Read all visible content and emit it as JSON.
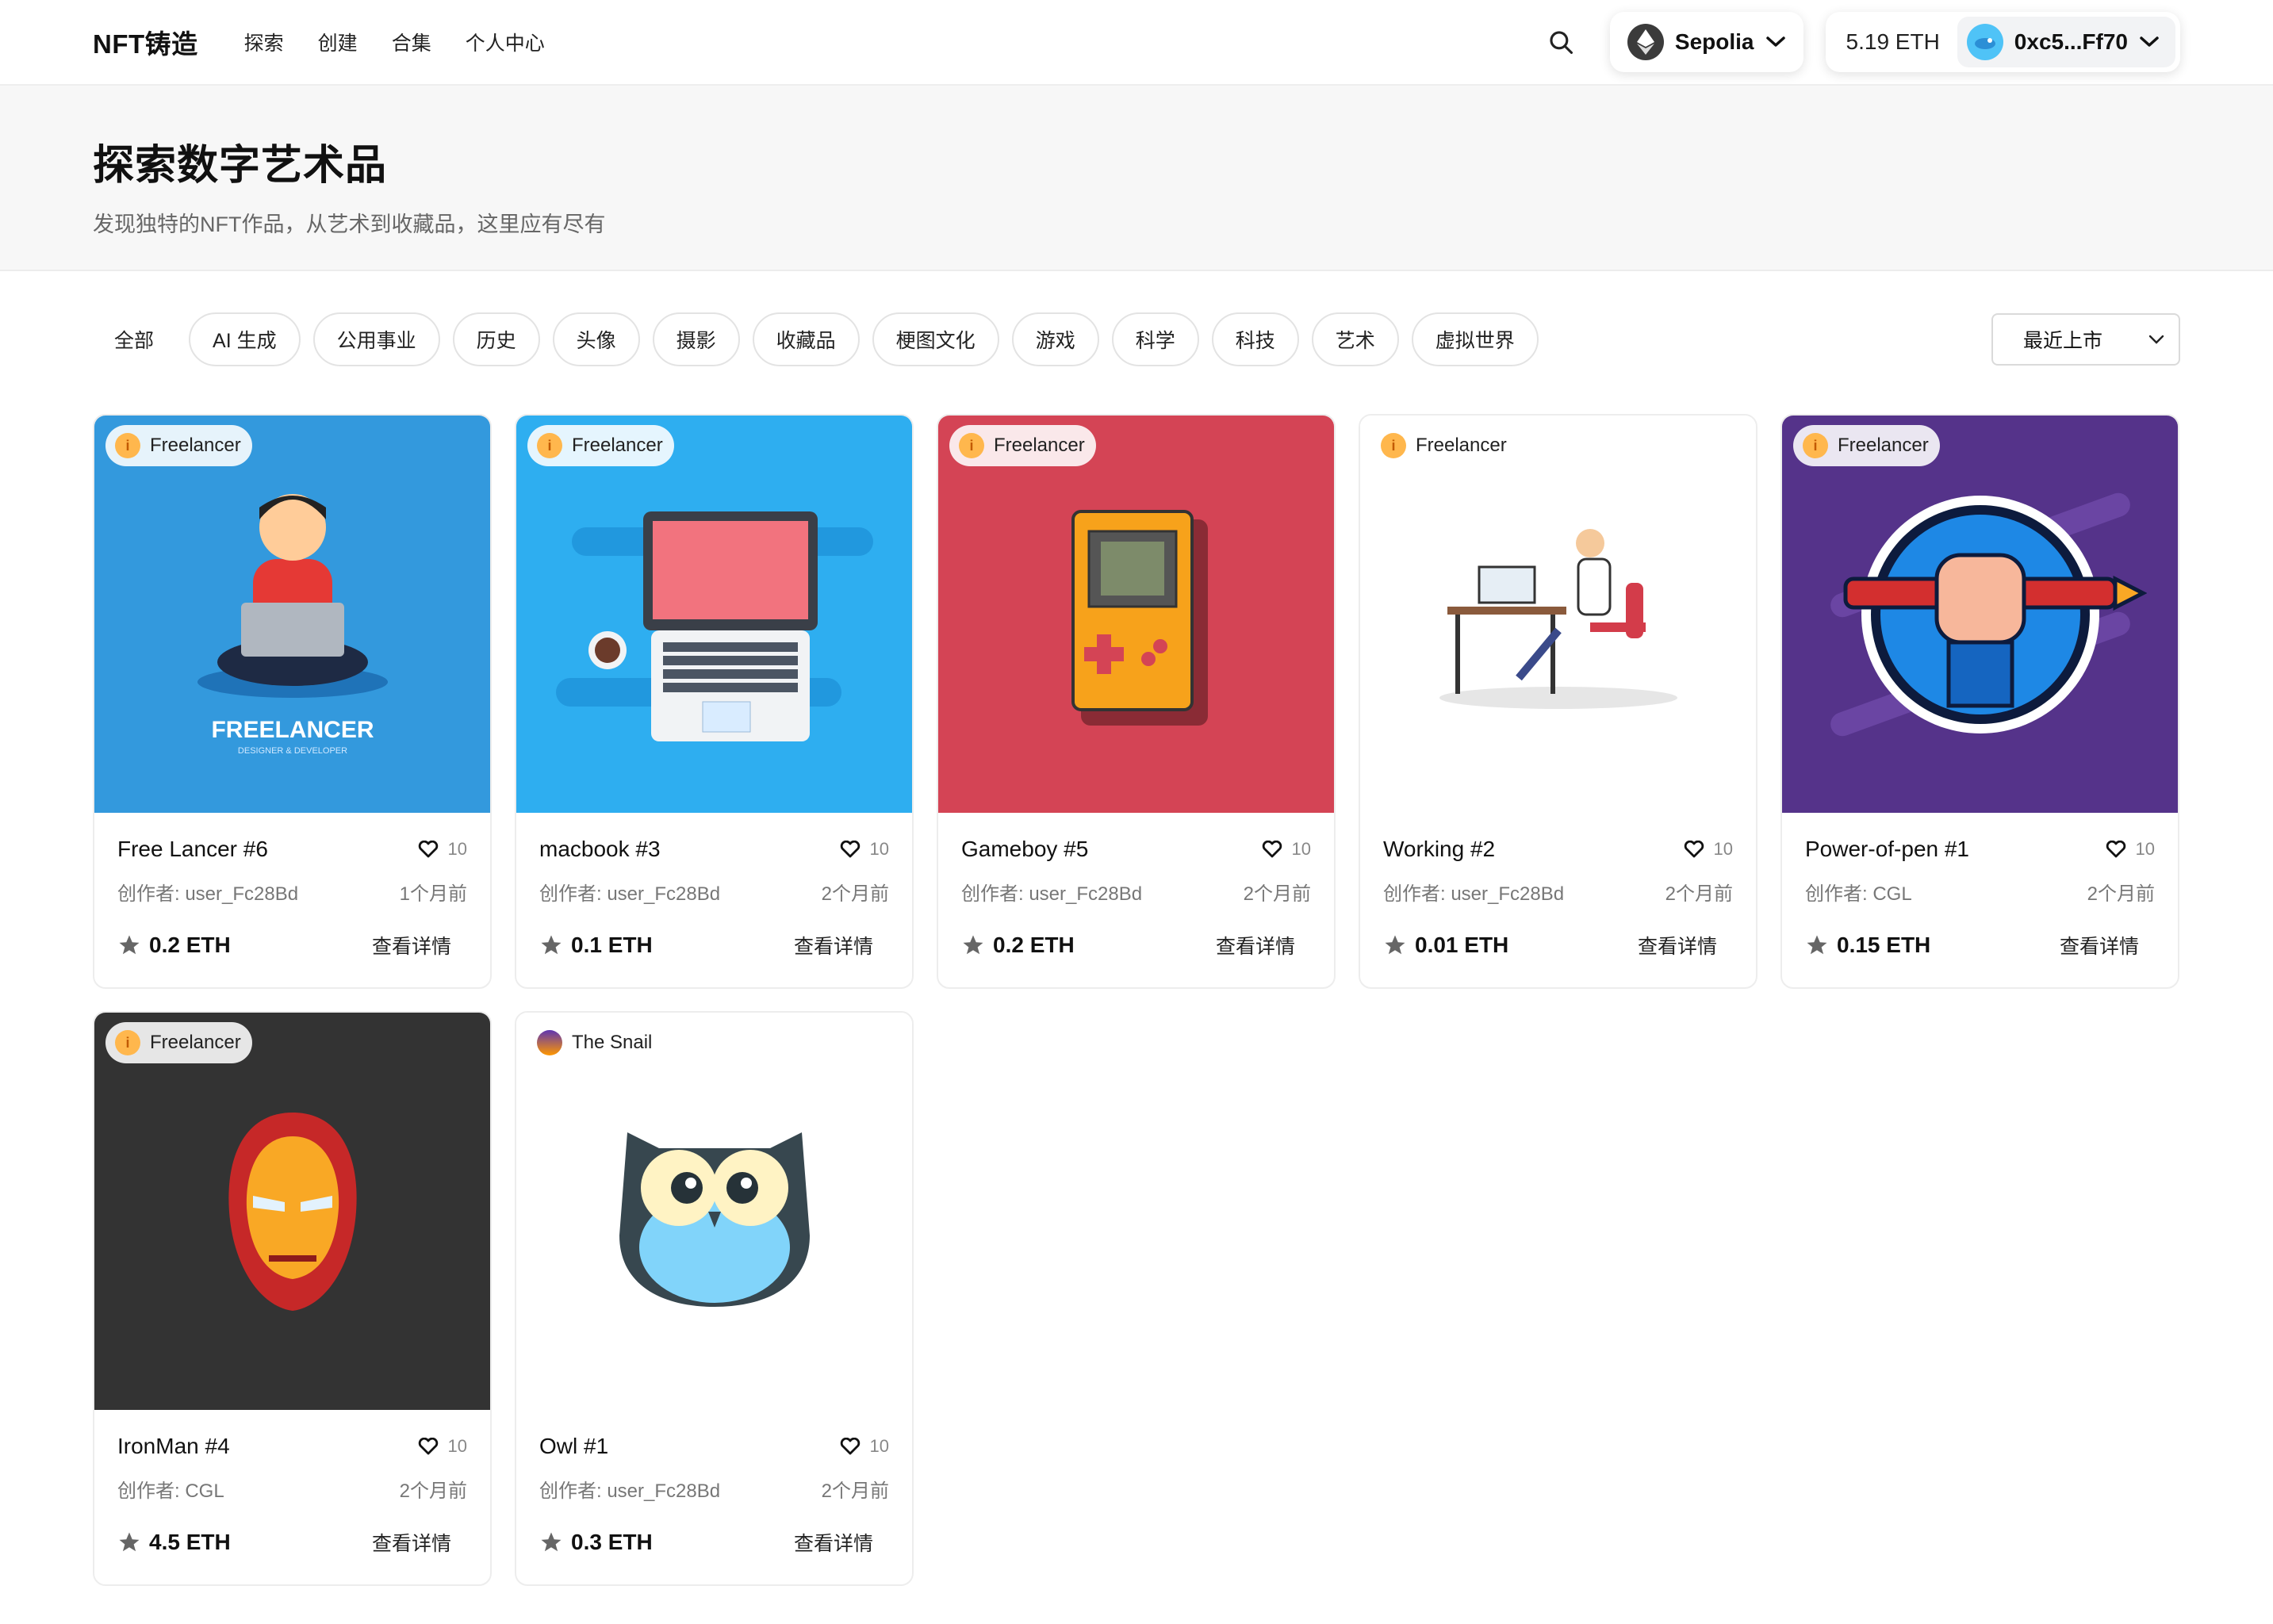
{
  "header": {
    "brand": "NFT铸造",
    "nav": [
      "探索",
      "创建",
      "合集",
      "个人中心"
    ],
    "network": "Sepolia",
    "balance": "5.19 ETH",
    "address": "0xc5...Ff70"
  },
  "hero": {
    "title": "探索数字艺术品",
    "subtitle": "发现独特的NFT作品，从艺术到收藏品，这里应有尽有"
  },
  "filters": {
    "categories": [
      "全部",
      "AI 生成",
      "公用事业",
      "历史",
      "头像",
      "摄影",
      "收藏品",
      "梗图文化",
      "游戏",
      "科学",
      "科技",
      "艺术",
      "虚拟世界"
    ],
    "sort": "最近上市"
  },
  "cards": [
    {
      "creator_badge": "Freelancer",
      "title": "Free Lancer #6",
      "likes": "10",
      "author": "创作者: user_Fc28Bd",
      "time": "1个月前",
      "price": "0.2 ETH",
      "detail": "查看详情",
      "bg": "#3399dd",
      "art": "FREELANCER",
      "art_sub": "DESIGNER & DEVELOPER"
    },
    {
      "creator_badge": "Freelancer",
      "title": "macbook #3",
      "likes": "10",
      "author": "创作者: user_Fc28Bd",
      "time": "2个月前",
      "price": "0.1 ETH",
      "detail": "查看详情",
      "bg": "#2eaef0"
    },
    {
      "creator_badge": "Freelancer",
      "title": "Gameboy #5",
      "likes": "10",
      "author": "创作者: user_Fc28Bd",
      "time": "2个月前",
      "price": "0.2 ETH",
      "detail": "查看详情",
      "bg": "#d44455"
    },
    {
      "creator_badge": "Freelancer",
      "title": "Working #2",
      "likes": "10",
      "author": "创作者: user_Fc28Bd",
      "time": "2个月前",
      "price": "0.01 ETH",
      "detail": "查看详情",
      "bg": "#ffffff"
    },
    {
      "creator_badge": "Freelancer",
      "title": "Power-of-pen #1",
      "likes": "10",
      "author": "创作者: CGL",
      "time": "2个月前",
      "price": "0.15 ETH",
      "detail": "查看详情",
      "bg": "#55338a"
    },
    {
      "creator_badge": "Freelancer",
      "title": "IronMan #4",
      "likes": "10",
      "author": "创作者: CGL",
      "time": "2个月前",
      "price": "4.5 ETH",
      "detail": "查看详情",
      "bg": "#333333"
    },
    {
      "creator_badge": "The Snail",
      "title": "Owl #1",
      "likes": "10",
      "author": "创作者: user_Fc28Bd",
      "time": "2个月前",
      "price": "0.3 ETH",
      "detail": "查看详情",
      "bg": "#ffffff"
    }
  ],
  "icons": {
    "search": "search-icon",
    "network": "ethereum-icon",
    "chevron": "chevron-down-icon",
    "like": "heart-icon",
    "price": "star-icon"
  }
}
